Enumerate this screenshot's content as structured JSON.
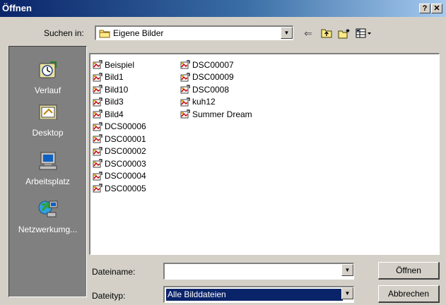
{
  "window": {
    "title": "Öffnen",
    "help_glyph": "?",
    "close_glyph": "✕"
  },
  "look_in": {
    "label": "Suchen in:",
    "value": "Eigene Bilder"
  },
  "toolbar": {
    "back_glyph": "⇐",
    "up_glyph": "⇧",
    "new_folder_glyph": "✱",
    "view_glyph": "▦▾"
  },
  "places": [
    {
      "label": "Verlauf",
      "icon": "history-icon"
    },
    {
      "label": "Desktop",
      "icon": "desktop-icon"
    },
    {
      "label": "Arbeitsplatz",
      "icon": "my-computer-icon"
    },
    {
      "label": "Netzwerkumg...",
      "icon": "network-icon"
    }
  ],
  "files": {
    "column1": [
      "Beispiel",
      "Bild1",
      "Bild10",
      "Bild3",
      "Bild4",
      "DCS00006",
      "DSC00001",
      "DSC00002",
      "DSC00003",
      "DSC00004",
      "DSC00005"
    ],
    "column2": [
      "DSC00007",
      "DSC00009",
      "DSC0008",
      "kuh12",
      "Summer Dream"
    ],
    "icon": "image-file-icon"
  },
  "filename": {
    "label": "Dateiname:",
    "value": ""
  },
  "filetype": {
    "label": "Dateityp:",
    "value": "Alle Bilddateien"
  },
  "buttons": {
    "open": "Öffnen",
    "cancel": "Abbrechen"
  },
  "colors": {
    "title_start": "#0a246a",
    "title_end": "#a6caf0",
    "face": "#d4d0c8",
    "places_bg": "#808080",
    "selection": "#0a246a"
  }
}
